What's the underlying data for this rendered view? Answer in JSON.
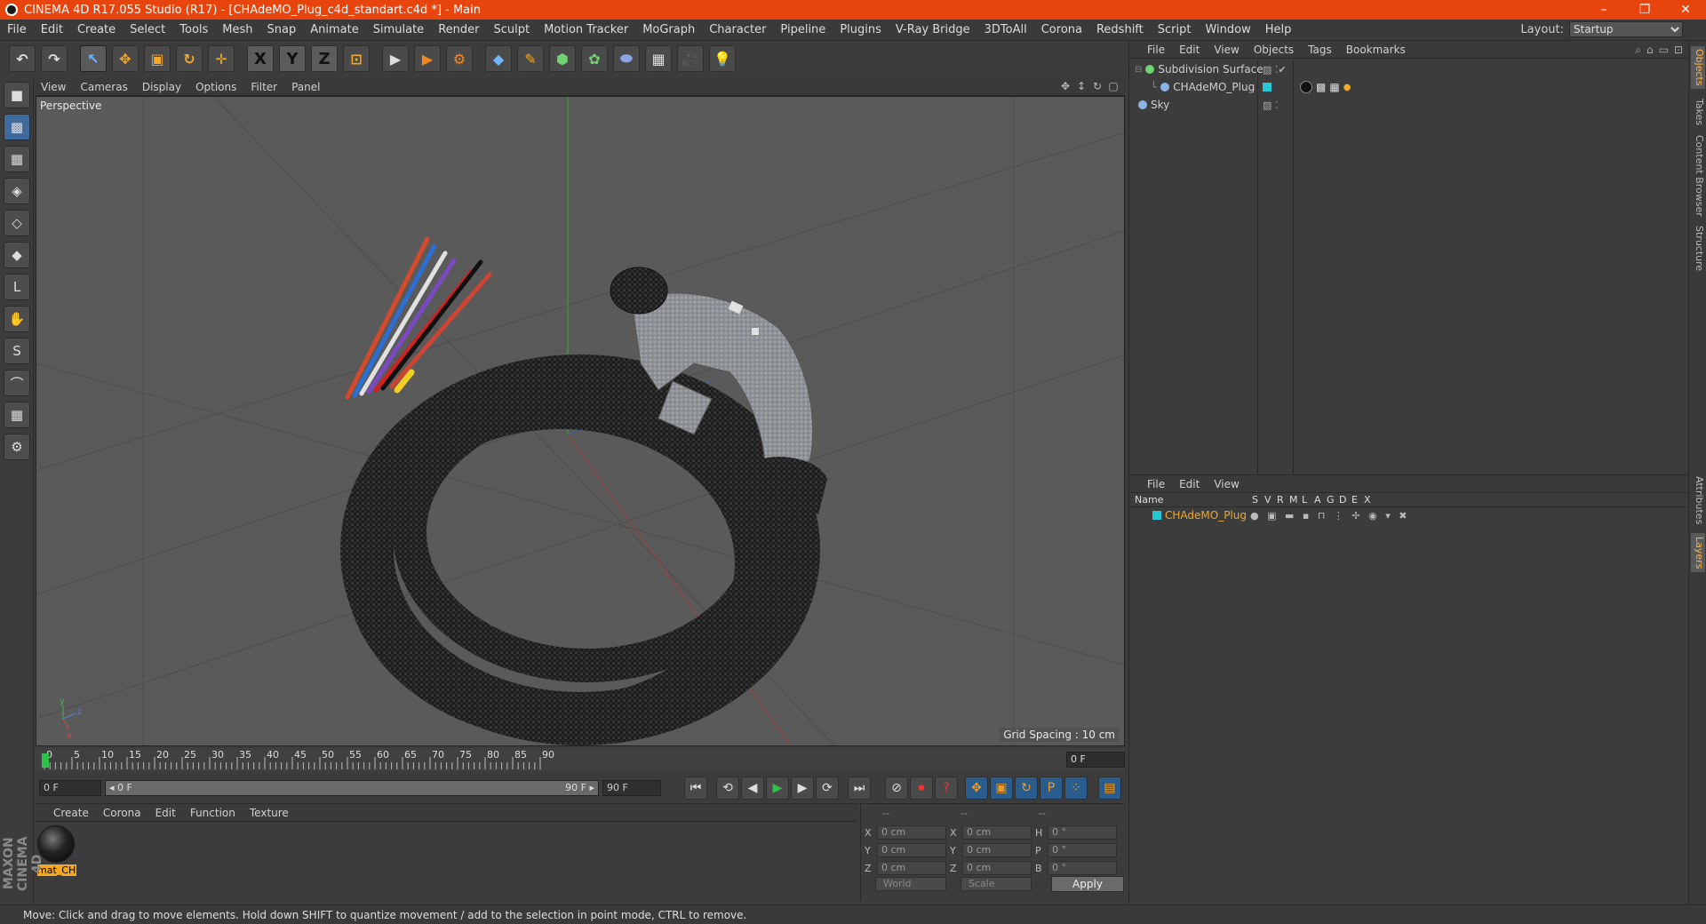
{
  "window": {
    "title": "CINEMA 4D R17.055 Studio (R17) - [CHAdeMO_Plug_c4d_standart.c4d *] - Main",
    "minimize": "–",
    "restore": "❐",
    "close": "✕"
  },
  "menu": {
    "items": [
      "File",
      "Edit",
      "Create",
      "Select",
      "Tools",
      "Mesh",
      "Snap",
      "Animate",
      "Simulate",
      "Render",
      "Sculpt",
      "Motion Tracker",
      "MoGraph",
      "Character",
      "Pipeline",
      "Plugins",
      "V-Ray Bridge",
      "3DToAll",
      "Corona",
      "Redshift",
      "Script",
      "Window",
      "Help"
    ],
    "layout_label": "Layout:",
    "layout_value": "Startup"
  },
  "toolbar": {
    "undo": "↶",
    "redo": "↷",
    "select": "↖",
    "move": "✥",
    "scale": "▣",
    "rotate": "↻",
    "last": "✛",
    "x": "X",
    "y": "Y",
    "z": "Z",
    "coord": "⊡",
    "render_view": "▶",
    "render_pic": "▶",
    "render_settings": "⚙",
    "cube": "◆",
    "pen": "✎",
    "subdiv": "⬢",
    "array": "✿",
    "deformer": "⬬",
    "floor": "▦",
    "camera": "🎥",
    "light": "💡"
  },
  "left_tools": [
    "■",
    "▩",
    "▦",
    "◈",
    "◇",
    "◆",
    "L",
    "✋",
    "S",
    "⌒",
    "▦",
    "⚙"
  ],
  "viewport": {
    "menu": [
      "View",
      "Cameras",
      "Display",
      "Options",
      "Filter",
      "Panel"
    ],
    "label": "Perspective",
    "grid_spacing": "Grid Spacing : 10 cm"
  },
  "timeline": {
    "ticks": [
      "0",
      "5",
      "10",
      "15",
      "20",
      "25",
      "30",
      "35",
      "40",
      "45",
      "50",
      "55",
      "60",
      "65",
      "70",
      "75",
      "80",
      "85",
      "90"
    ],
    "current_frame": "0 F",
    "start": "0 F",
    "slider_start": "◂ 0 F",
    "slider_end": "90 F ▸",
    "end": "90 F"
  },
  "transport": {
    "first": "⏮",
    "prev_key": "⟲",
    "prev": "◀",
    "play": "▶",
    "next": "▶",
    "next_key": "⟳",
    "last": "⏭",
    "rec": "⊘",
    "autokey": "⏺",
    "keyhelp": "?",
    "move": "✥",
    "scale": "▣",
    "rotate": "↻",
    "param": "P",
    "pla": "⁘",
    "film": "▤"
  },
  "materials": {
    "menu": [
      "Create",
      "Corona",
      "Edit",
      "Function",
      "Texture"
    ],
    "items": [
      {
        "name": "mat_CH."
      }
    ]
  },
  "coords": {
    "head": [
      "--",
      "--",
      "--"
    ],
    "rows": [
      {
        "l1": "X",
        "v1": "0 cm",
        "l2": "X",
        "v2": "0 cm",
        "l3": "H",
        "v3": "0 °"
      },
      {
        "l1": "Y",
        "v1": "0 cm",
        "l2": "Y",
        "v2": "0 cm",
        "l3": "P",
        "v3": "0 °"
      },
      {
        "l1": "Z",
        "v1": "0 cm",
        "l2": "Z",
        "v2": "0 cm",
        "l3": "B",
        "v3": "0 °"
      }
    ],
    "world": "World",
    "scale": "Scale",
    "apply": "Apply"
  },
  "objects": {
    "menu": [
      "File",
      "Edit",
      "View",
      "Objects",
      "Tags",
      "Bookmarks"
    ],
    "items": [
      {
        "name": "Subdivision Surface",
        "color": "#6fd36f"
      },
      {
        "name": "CHAdeMO_Plug",
        "color": "#8ab4e6"
      },
      {
        "name": "Sky",
        "color": "#8ab4e6"
      }
    ]
  },
  "layers": {
    "menu": [
      "File",
      "Edit",
      "View"
    ],
    "columns": [
      "Name",
      "S",
      "V",
      "R",
      "M",
      "L",
      "A",
      "G",
      "D",
      "E",
      "X"
    ],
    "items": [
      {
        "name": "CHAdeMO_Plug",
        "color": "#29c6d6"
      }
    ]
  },
  "side_tabs": [
    "Objects",
    "Takes",
    "Content Browser",
    "Structure",
    "Attributes",
    "Layers"
  ],
  "brand": "MAXON CINEMA 4D",
  "status": "Move: Click and drag to move elements. Hold down SHIFT to quantize movement / add to the selection in point mode, CTRL to remove.",
  "colors": {
    "accent": "#e8440e",
    "highlight": "#f3a826",
    "play": "#2ec24a",
    "grid_y": "#3fa03f",
    "grid_x": "#a04040"
  }
}
